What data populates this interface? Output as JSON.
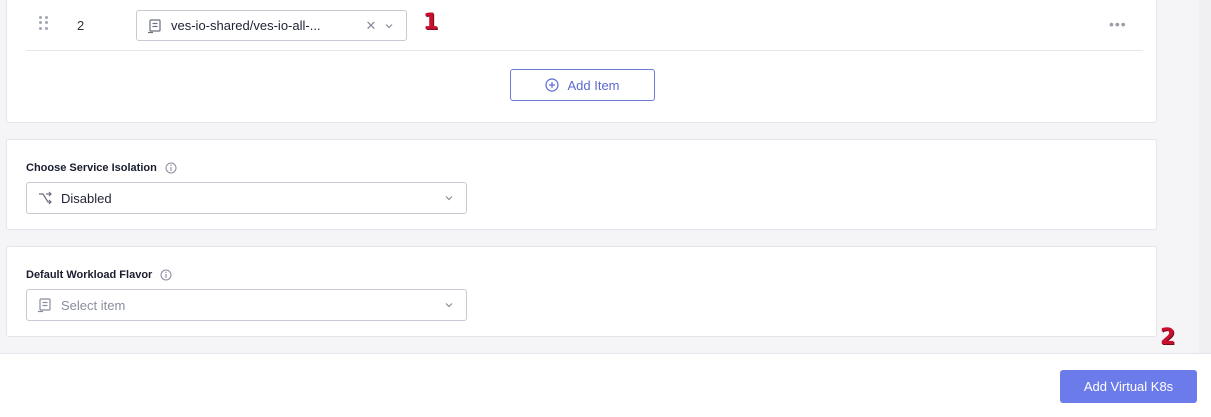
{
  "list": {
    "rows": [
      {
        "index": "2",
        "value": "ves-io-shared/ves-io-all-...",
        "clear_icon": "close-icon",
        "more_label": "•••"
      }
    ],
    "add_item_label": "Add Item"
  },
  "service_isolation": {
    "label": "Choose Service Isolation",
    "value": "Disabled",
    "icon": "branch-icon"
  },
  "workload_flavor": {
    "label": "Default Workload Flavor",
    "placeholder": "Select item",
    "icon": "list-icon"
  },
  "footer": {
    "submit_label": "Add Virtual K8s"
  },
  "markers": {
    "first": "1",
    "second": "2"
  },
  "colors": {
    "accent": "#6c7bea",
    "marker": "#c8102e"
  }
}
